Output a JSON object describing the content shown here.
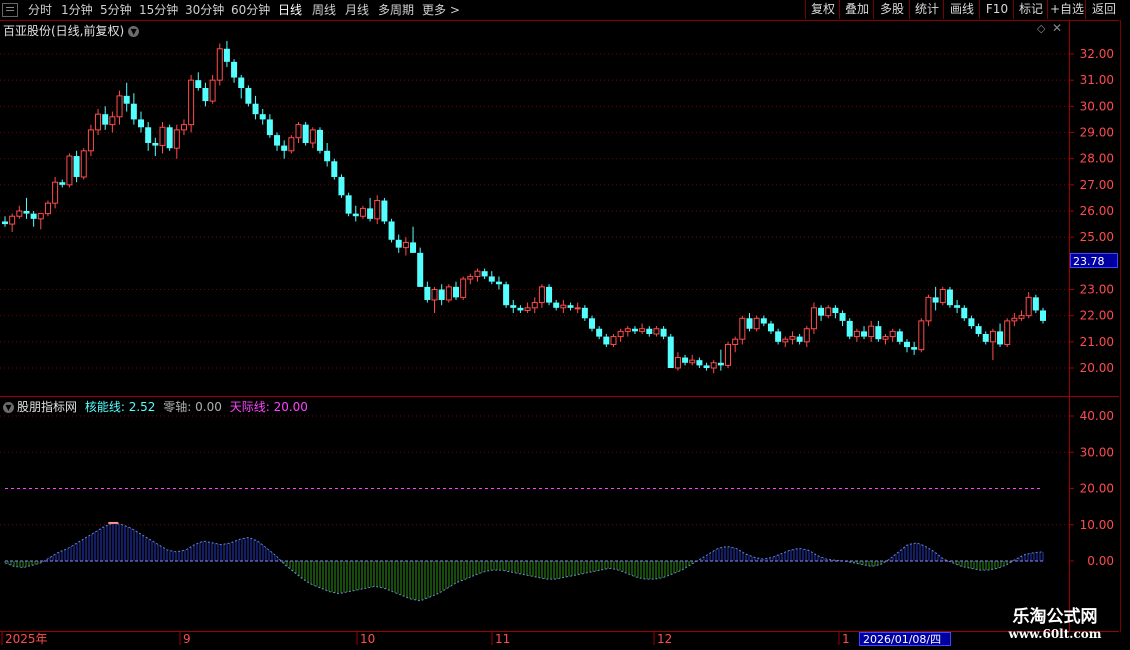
{
  "toolbar": {
    "periods": [
      "分时",
      "1分钟",
      "5分钟",
      "15分钟",
      "30分钟",
      "60分钟",
      "日线",
      "周线",
      "月线",
      "多周期",
      "更多 >"
    ],
    "active_period": "日线",
    "buttons": [
      "复权",
      "叠加",
      "多股",
      "统计",
      "画线",
      "F10",
      "标记",
      "+自选",
      "返回"
    ]
  },
  "main_chart": {
    "title": "百亚股份(日线,前复权)",
    "y_ticks": [
      "32.00",
      "31.00",
      "30.00",
      "29.00",
      "28.00",
      "27.00",
      "26.00",
      "25.00",
      "23.00",
      "22.00",
      "21.00",
      "20.00"
    ],
    "current_price": "23.78",
    "up_color": "#ff4c4c",
    "down_color": "#54ffff"
  },
  "indicator": {
    "name": "股朋指标网",
    "core_label": "核能线:",
    "core_value": "2.52",
    "zero_label": "零轴:",
    "zero_value": "0.00",
    "sky_label": "天际线:",
    "sky_value": "20.00",
    "y_ticks": [
      "40.00",
      "30.00",
      "20.00",
      "10.00",
      "0.00"
    ]
  },
  "x_axis": {
    "labels": [
      "2025年",
      "9",
      "10",
      "11",
      "12",
      "1"
    ],
    "cursor_date": "2026/01/08/四"
  },
  "watermark": {
    "line1": "乐淘公式网",
    "line2": "www.60lt.com"
  },
  "chart_data": [
    {
      "type": "candlestick",
      "title": "百亚股份(日线,前复权)",
      "y_axis_range": [
        19.5,
        32.5
      ],
      "ohlc": [
        [
          25.6,
          25.8,
          25.4,
          25.5
        ],
        [
          25.5,
          25.9,
          25.2,
          25.8
        ],
        [
          25.8,
          26.2,
          25.7,
          26.0
        ],
        [
          26.0,
          26.5,
          25.7,
          25.9
        ],
        [
          25.9,
          26.0,
          25.4,
          25.7
        ],
        [
          25.7,
          25.9,
          25.3,
          25.9
        ],
        [
          25.9,
          26.4,
          25.8,
          26.3
        ],
        [
          26.3,
          27.3,
          26.1,
          27.1
        ],
        [
          27.1,
          27.2,
          26.9,
          27.0
        ],
        [
          27.0,
          28.2,
          26.9,
          28.1
        ],
        [
          28.1,
          28.3,
          27.1,
          27.3
        ],
        [
          27.3,
          28.4,
          27.2,
          28.3
        ],
        [
          28.3,
          29.3,
          28.1,
          29.1
        ],
        [
          29.1,
          29.9,
          28.9,
          29.7
        ],
        [
          29.7,
          30.0,
          29.1,
          29.3
        ],
        [
          29.3,
          29.8,
          29.0,
          29.6
        ],
        [
          29.6,
          30.6,
          29.3,
          30.4
        ],
        [
          30.4,
          30.9,
          29.8,
          30.1
        ],
        [
          30.1,
          30.5,
          29.3,
          29.5
        ],
        [
          29.5,
          29.8,
          29.0,
          29.2
        ],
        [
          29.2,
          29.4,
          28.3,
          28.6
        ],
        [
          28.6,
          28.8,
          28.1,
          28.5
        ],
        [
          28.5,
          29.4,
          28.2,
          29.2
        ],
        [
          29.2,
          29.3,
          28.3,
          28.4
        ],
        [
          28.4,
          29.3,
          28.0,
          29.1
        ],
        [
          29.1,
          29.5,
          28.9,
          29.3
        ],
        [
          29.3,
          31.2,
          29.0,
          31.0
        ],
        [
          31.0,
          31.3,
          30.6,
          30.7
        ],
        [
          30.7,
          30.9,
          30.0,
          30.2
        ],
        [
          30.2,
          31.2,
          30.1,
          31.0
        ],
        [
          31.0,
          32.4,
          30.8,
          32.2
        ],
        [
          32.2,
          32.5,
          31.5,
          31.7
        ],
        [
          31.7,
          31.8,
          30.9,
          31.1
        ],
        [
          31.1,
          31.2,
          30.3,
          30.7
        ],
        [
          30.7,
          30.8,
          30.0,
          30.1
        ],
        [
          30.1,
          30.4,
          29.5,
          29.7
        ],
        [
          29.7,
          29.9,
          29.3,
          29.5
        ],
        [
          29.5,
          29.7,
          28.8,
          28.9
        ],
        [
          28.9,
          29.0,
          28.3,
          28.5
        ],
        [
          28.5,
          28.7,
          28.0,
          28.3
        ],
        [
          28.3,
          28.9,
          28.2,
          28.8
        ],
        [
          28.8,
          29.4,
          28.6,
          29.3
        ],
        [
          29.3,
          29.4,
          28.5,
          28.6
        ],
        [
          28.6,
          29.2,
          28.4,
          29.1
        ],
        [
          29.1,
          29.2,
          28.2,
          28.3
        ],
        [
          28.3,
          28.6,
          27.7,
          27.9
        ],
        [
          27.9,
          28.0,
          27.2,
          27.3
        ],
        [
          27.3,
          27.4,
          26.5,
          26.6
        ],
        [
          26.6,
          26.7,
          25.8,
          25.9
        ],
        [
          25.9,
          26.2,
          25.6,
          25.8
        ],
        [
          25.8,
          26.2,
          25.7,
          26.1
        ],
        [
          26.1,
          26.5,
          25.6,
          25.7
        ],
        [
          25.7,
          26.6,
          25.5,
          26.4
        ],
        [
          26.4,
          26.5,
          25.5,
          25.6
        ],
        [
          25.6,
          25.7,
          24.8,
          24.9
        ],
        [
          24.9,
          25.1,
          24.4,
          24.6
        ],
        [
          24.6,
          25.0,
          24.3,
          24.8
        ],
        [
          24.8,
          25.4,
          24.4,
          24.4
        ],
        [
          24.4,
          24.6,
          23.1,
          23.1
        ],
        [
          23.1,
          23.3,
          22.5,
          22.6
        ],
        [
          22.6,
          23.1,
          22.1,
          23.0
        ],
        [
          23.0,
          23.2,
          22.4,
          22.6
        ],
        [
          22.6,
          23.2,
          22.5,
          23.1
        ],
        [
          23.1,
          23.3,
          22.6,
          22.7
        ],
        [
          22.7,
          23.5,
          22.6,
          23.4
        ],
        [
          23.4,
          23.6,
          23.2,
          23.5
        ],
        [
          23.5,
          23.8,
          23.3,
          23.7
        ],
        [
          23.7,
          23.8,
          23.4,
          23.5
        ],
        [
          23.5,
          23.7,
          23.2,
          23.3
        ],
        [
          23.3,
          23.5,
          23.0,
          23.2
        ],
        [
          23.2,
          23.3,
          22.3,
          22.4
        ],
        [
          22.4,
          22.6,
          22.1,
          22.3
        ],
        [
          22.3,
          22.4,
          22.1,
          22.2
        ],
        [
          22.2,
          22.5,
          22.1,
          22.3
        ],
        [
          22.3,
          22.7,
          22.1,
          22.5
        ],
        [
          22.5,
          23.2,
          22.3,
          23.1
        ],
        [
          23.1,
          23.2,
          22.4,
          22.5
        ],
        [
          22.5,
          22.6,
          22.2,
          22.3
        ],
        [
          22.3,
          22.6,
          22.1,
          22.4
        ],
        [
          22.4,
          22.5,
          22.2,
          22.3
        ],
        [
          22.3,
          22.5,
          22.1,
          22.3
        ],
        [
          22.3,
          22.4,
          21.8,
          21.9
        ],
        [
          21.9,
          22.0,
          21.4,
          21.5
        ],
        [
          21.5,
          21.6,
          21.1,
          21.2
        ],
        [
          21.2,
          21.3,
          20.8,
          20.9
        ],
        [
          20.9,
          21.3,
          20.8,
          21.2
        ],
        [
          21.2,
          21.5,
          21.0,
          21.4
        ],
        [
          21.4,
          21.6,
          21.2,
          21.5
        ],
        [
          21.5,
          21.6,
          21.3,
          21.4
        ],
        [
          21.4,
          21.7,
          21.3,
          21.5
        ],
        [
          21.5,
          21.6,
          21.2,
          21.3
        ],
        [
          21.3,
          21.6,
          21.2,
          21.5
        ],
        [
          21.5,
          21.6,
          21.1,
          21.2
        ],
        [
          21.2,
          21.3,
          20.0,
          20.0
        ],
        [
          20.0,
          20.6,
          19.9,
          20.4
        ],
        [
          20.4,
          20.5,
          20.1,
          20.2
        ],
        [
          20.2,
          20.5,
          20.1,
          20.3
        ],
        [
          20.3,
          20.4,
          20.0,
          20.1
        ],
        [
          20.1,
          20.2,
          19.9,
          20.0
        ],
        [
          20.0,
          20.3,
          19.8,
          20.2
        ],
        [
          20.2,
          20.7,
          19.9,
          20.1
        ],
        [
          20.1,
          21.0,
          20.0,
          20.9
        ],
        [
          20.9,
          21.2,
          20.6,
          21.1
        ],
        [
          21.1,
          22.0,
          20.9,
          21.9
        ],
        [
          21.9,
          22.1,
          21.4,
          21.5
        ],
        [
          21.5,
          22.0,
          21.4,
          21.9
        ],
        [
          21.9,
          22.0,
          21.6,
          21.7
        ],
        [
          21.7,
          21.8,
          21.3,
          21.4
        ],
        [
          21.4,
          21.5,
          20.9,
          21.0
        ],
        [
          21.0,
          21.2,
          20.8,
          21.1
        ],
        [
          21.1,
          21.4,
          20.9,
          21.2
        ],
        [
          21.2,
          21.3,
          20.9,
          21.0
        ],
        [
          21.0,
          21.6,
          20.8,
          21.5
        ],
        [
          21.5,
          22.5,
          21.3,
          22.3
        ],
        [
          22.3,
          22.4,
          21.8,
          22.0
        ],
        [
          22.0,
          22.4,
          21.9,
          22.3
        ],
        [
          22.3,
          22.4,
          21.9,
          22.1
        ],
        [
          22.1,
          22.2,
          21.6,
          21.8
        ],
        [
          21.8,
          21.9,
          21.1,
          21.2
        ],
        [
          21.2,
          21.5,
          21.0,
          21.4
        ],
        [
          21.4,
          21.6,
          21.1,
          21.2
        ],
        [
          21.2,
          21.8,
          21.0,
          21.6
        ],
        [
          21.6,
          21.8,
          21.0,
          21.1
        ],
        [
          21.1,
          21.3,
          20.9,
          21.2
        ],
        [
          21.2,
          21.5,
          21.0,
          21.4
        ],
        [
          21.4,
          21.5,
          20.9,
          21.0
        ],
        [
          21.0,
          21.1,
          20.6,
          20.8
        ],
        [
          20.8,
          21.0,
          20.5,
          20.7
        ],
        [
          20.7,
          21.9,
          20.6,
          21.8
        ],
        [
          21.8,
          22.8,
          21.6,
          22.7
        ],
        [
          22.7,
          23.1,
          22.2,
          22.5
        ],
        [
          22.5,
          23.1,
          22.4,
          23.0
        ],
        [
          23.0,
          23.1,
          22.3,
          22.4
        ],
        [
          22.4,
          22.6,
          22.1,
          22.3
        ],
        [
          22.3,
          22.4,
          21.8,
          21.9
        ],
        [
          21.9,
          22.0,
          21.5,
          21.6
        ],
        [
          21.6,
          21.7,
          21.2,
          21.3
        ],
        [
          21.3,
          21.4,
          20.9,
          21.0
        ],
        [
          21.0,
          21.5,
          20.3,
          21.4
        ],
        [
          21.4,
          21.7,
          20.8,
          20.9
        ],
        [
          20.9,
          21.9,
          20.8,
          21.8
        ],
        [
          21.8,
          22.1,
          21.6,
          21.9
        ],
        [
          21.9,
          22.2,
          21.8,
          22.0
        ],
        [
          22.0,
          22.9,
          21.9,
          22.7
        ],
        [
          22.7,
          22.8,
          22.1,
          22.2
        ],
        [
          22.2,
          22.3,
          21.7,
          21.8
        ]
      ]
    },
    {
      "type": "area",
      "title": "股朋指标网",
      "series": [
        {
          "name": "核能线",
          "values": [
            -0.5,
            -1.5,
            -1.8,
            -1.2,
            -0.5,
            1.0,
            2.5,
            3.5,
            5.0,
            6.5,
            8.0,
            9.5,
            10.5,
            10.0,
            9.0,
            7.5,
            6.0,
            4.5,
            3.0,
            2.5,
            3.0,
            4.5,
            5.5,
            5.0,
            4.5,
            5.0,
            6.0,
            6.5,
            5.5,
            3.5,
            1.5,
            -1.0,
            -3.0,
            -5.0,
            -6.5,
            -7.5,
            -8.5,
            -9.0,
            -8.5,
            -8.0,
            -7.5,
            -7.0,
            -7.5,
            -8.5,
            -9.5,
            -10.5,
            -11.0,
            -10.0,
            -9.0,
            -7.5,
            -6.0,
            -5.0,
            -4.0,
            -3.0,
            -2.5,
            -2.5,
            -3.0,
            -3.5,
            -4.0,
            -4.5,
            -5.0,
            -5.0,
            -4.5,
            -4.0,
            -3.5,
            -3.0,
            -2.5,
            -2.0,
            -2.5,
            -3.5,
            -4.5,
            -5.0,
            -5.0,
            -4.5,
            -3.5,
            -2.5,
            -1.0,
            0.5,
            2.0,
            3.5,
            4.0,
            3.5,
            2.0,
            1.0,
            0.5,
            1.0,
            2.0,
            3.0,
            3.5,
            3.0,
            1.5,
            0.5,
            0.2,
            0.0,
            -0.5,
            -1.0,
            -1.5,
            -1.0,
            0.5,
            2.5,
            4.5,
            5.0,
            4.0,
            2.5,
            0.5,
            -0.5,
            -1.5,
            -2.0,
            -2.5,
            -2.5,
            -2.0,
            -1.0,
            0.5,
            1.8,
            2.3,
            2.52
          ]
        }
      ],
      "reference_lines": {
        "零轴": 0.0,
        "天际线": 20.0
      },
      "y_axis_range": [
        -12,
        45
      ]
    }
  ]
}
